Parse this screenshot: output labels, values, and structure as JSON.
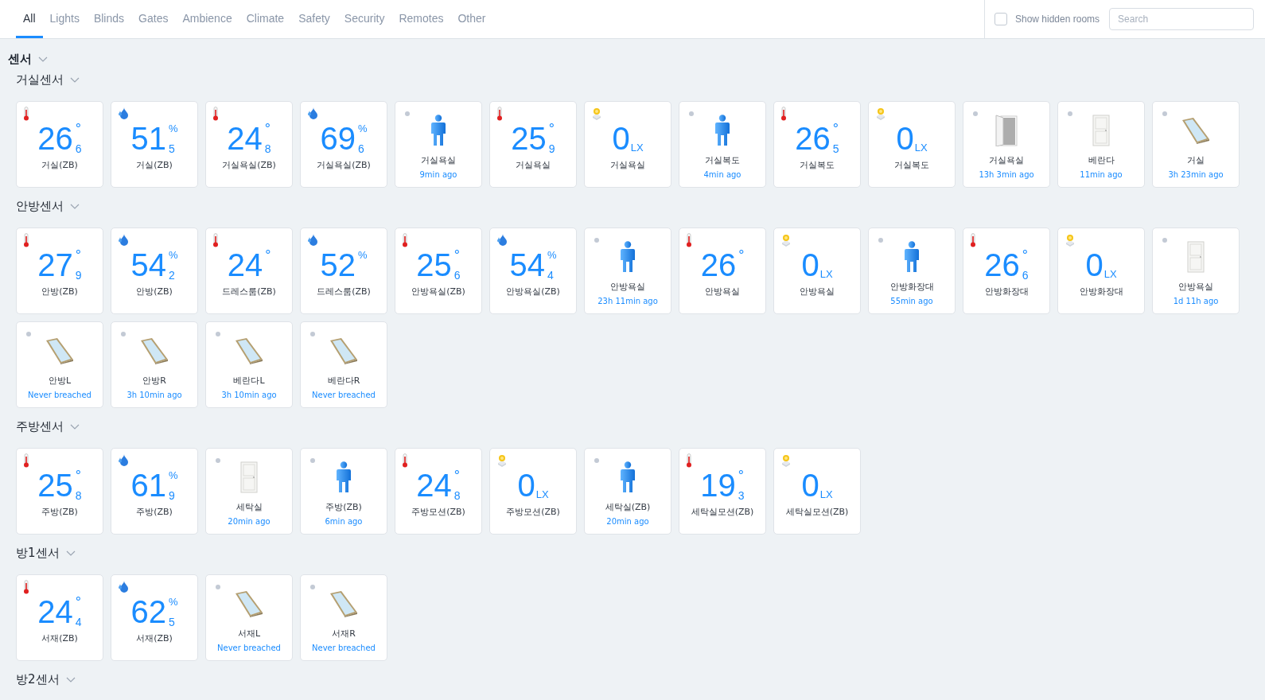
{
  "tabs": [
    {
      "label": "All",
      "selected": true
    },
    {
      "label": "Lights",
      "selected": false
    },
    {
      "label": "Blinds",
      "selected": false
    },
    {
      "label": "Gates",
      "selected": false
    },
    {
      "label": "Ambience",
      "selected": false
    },
    {
      "label": "Climate",
      "selected": false
    },
    {
      "label": "Safety",
      "selected": false
    },
    {
      "label": "Security",
      "selected": false
    },
    {
      "label": "Remotes",
      "selected": false
    },
    {
      "label": "Other",
      "selected": false
    }
  ],
  "show_hidden_rooms": {
    "label": "Show hidden rooms",
    "checked": false
  },
  "search": {
    "placeholder": "Search"
  },
  "section": {
    "title": "센서",
    "expanded": true
  },
  "groups": [
    {
      "title": "거실센서",
      "expanded": true,
      "tiles": [
        {
          "kind": "temperature",
          "value": "26",
          "decimal": "6",
          "unit": "°",
          "name": "거실(ZB)"
        },
        {
          "kind": "humidity",
          "value": "51",
          "decimal": "5",
          "unit": "%",
          "name": "거실(ZB)"
        },
        {
          "kind": "temperature",
          "value": "24",
          "decimal": "8",
          "unit": "°",
          "name": "거실욕실(ZB)"
        },
        {
          "kind": "humidity",
          "value": "69",
          "decimal": "6",
          "unit": "%",
          "name": "거실욕실(ZB)"
        },
        {
          "kind": "motion",
          "name": "거실욕실",
          "time": "9min ago"
        },
        {
          "kind": "temperature",
          "value": "25",
          "decimal": "9",
          "unit": "°",
          "name": "거실욕실"
        },
        {
          "kind": "light",
          "value": "0",
          "unit": "LX",
          "name": "거실욕실"
        },
        {
          "kind": "motion",
          "name": "거실복도",
          "time": "4min ago"
        },
        {
          "kind": "temperature",
          "value": "26",
          "decimal": "5",
          "unit": "°",
          "name": "거실복도"
        },
        {
          "kind": "light",
          "value": "0",
          "unit": "LX",
          "name": "거실복도"
        },
        {
          "kind": "door",
          "open": true,
          "name": "거실욕실",
          "time": "13h 3min ago"
        },
        {
          "kind": "door",
          "open": false,
          "name": "베란다",
          "time": "11min ago"
        },
        {
          "kind": "window",
          "name": "거실",
          "time": "3h 23min ago"
        }
      ]
    },
    {
      "title": "안방센서",
      "expanded": true,
      "tiles": [
        {
          "kind": "temperature",
          "value": "27",
          "decimal": "9",
          "unit": "°",
          "name": "안방(ZB)"
        },
        {
          "kind": "humidity",
          "value": "54",
          "decimal": "2",
          "unit": "%",
          "name": "안방(ZB)"
        },
        {
          "kind": "temperature",
          "value": "24",
          "unit": "°",
          "name": "드레스룸(ZB)"
        },
        {
          "kind": "humidity",
          "value": "52",
          "unit": "%",
          "name": "드레스룸(ZB)"
        },
        {
          "kind": "temperature",
          "value": "25",
          "decimal": "6",
          "unit": "°",
          "name": "안방욕실(ZB)"
        },
        {
          "kind": "humidity",
          "value": "54",
          "decimal": "4",
          "unit": "%",
          "name": "안방욕실(ZB)"
        },
        {
          "kind": "motion",
          "name": "안방욕실",
          "time": "23h 11min ago"
        },
        {
          "kind": "temperature",
          "value": "26",
          "unit": "°",
          "name": "안방욕실"
        },
        {
          "kind": "light",
          "value": "0",
          "unit": "LX",
          "name": "안방욕실"
        },
        {
          "kind": "motion",
          "name": "안방화장대",
          "time": "55min ago"
        },
        {
          "kind": "temperature",
          "value": "26",
          "decimal": "6",
          "unit": "°",
          "name": "안방화장대"
        },
        {
          "kind": "light",
          "value": "0",
          "unit": "LX",
          "name": "안방화장대"
        },
        {
          "kind": "door",
          "open": false,
          "name": "안방욕실",
          "time": "1d 11h ago"
        },
        {
          "kind": "window",
          "name": "안방L",
          "time": "Never breached"
        },
        {
          "kind": "window",
          "name": "안방R",
          "time": "3h 10min ago"
        },
        {
          "kind": "window",
          "name": "베란다L",
          "time": "3h 10min ago"
        },
        {
          "kind": "window",
          "name": "베란다R",
          "time": "Never breached"
        }
      ]
    },
    {
      "title": "주방센서",
      "expanded": true,
      "tiles": [
        {
          "kind": "temperature",
          "value": "25",
          "decimal": "8",
          "unit": "°",
          "name": "주방(ZB)"
        },
        {
          "kind": "humidity",
          "value": "61",
          "decimal": "9",
          "unit": "%",
          "name": "주방(ZB)"
        },
        {
          "kind": "door",
          "open": false,
          "name": "세탁실",
          "time": "20min ago"
        },
        {
          "kind": "motion",
          "name": "주방(ZB)",
          "time": "6min ago"
        },
        {
          "kind": "temperature",
          "value": "24",
          "decimal": "8",
          "unit": "°",
          "name": "주방모션(ZB)"
        },
        {
          "kind": "light",
          "value": "0",
          "unit": "LX",
          "name": "주방모션(ZB)"
        },
        {
          "kind": "motion",
          "name": "세탁실(ZB)",
          "time": "20min ago"
        },
        {
          "kind": "temperature",
          "value": "19",
          "decimal": "3",
          "unit": "°",
          "name": "세탁실모션(ZB)"
        },
        {
          "kind": "light",
          "value": "0",
          "unit": "LX",
          "name": "세탁실모션(ZB)"
        }
      ]
    },
    {
      "title": "방1센서",
      "expanded": true,
      "tiles": [
        {
          "kind": "temperature",
          "value": "24",
          "decimal": "4",
          "unit": "°",
          "name": "서재(ZB)"
        },
        {
          "kind": "humidity",
          "value": "62",
          "decimal": "5",
          "unit": "%",
          "name": "서재(ZB)"
        },
        {
          "kind": "window",
          "name": "서재L",
          "time": "Never breached"
        },
        {
          "kind": "window",
          "name": "서재R",
          "time": "Never breached"
        }
      ]
    },
    {
      "title": "방2센서",
      "expanded": true
    }
  ]
}
